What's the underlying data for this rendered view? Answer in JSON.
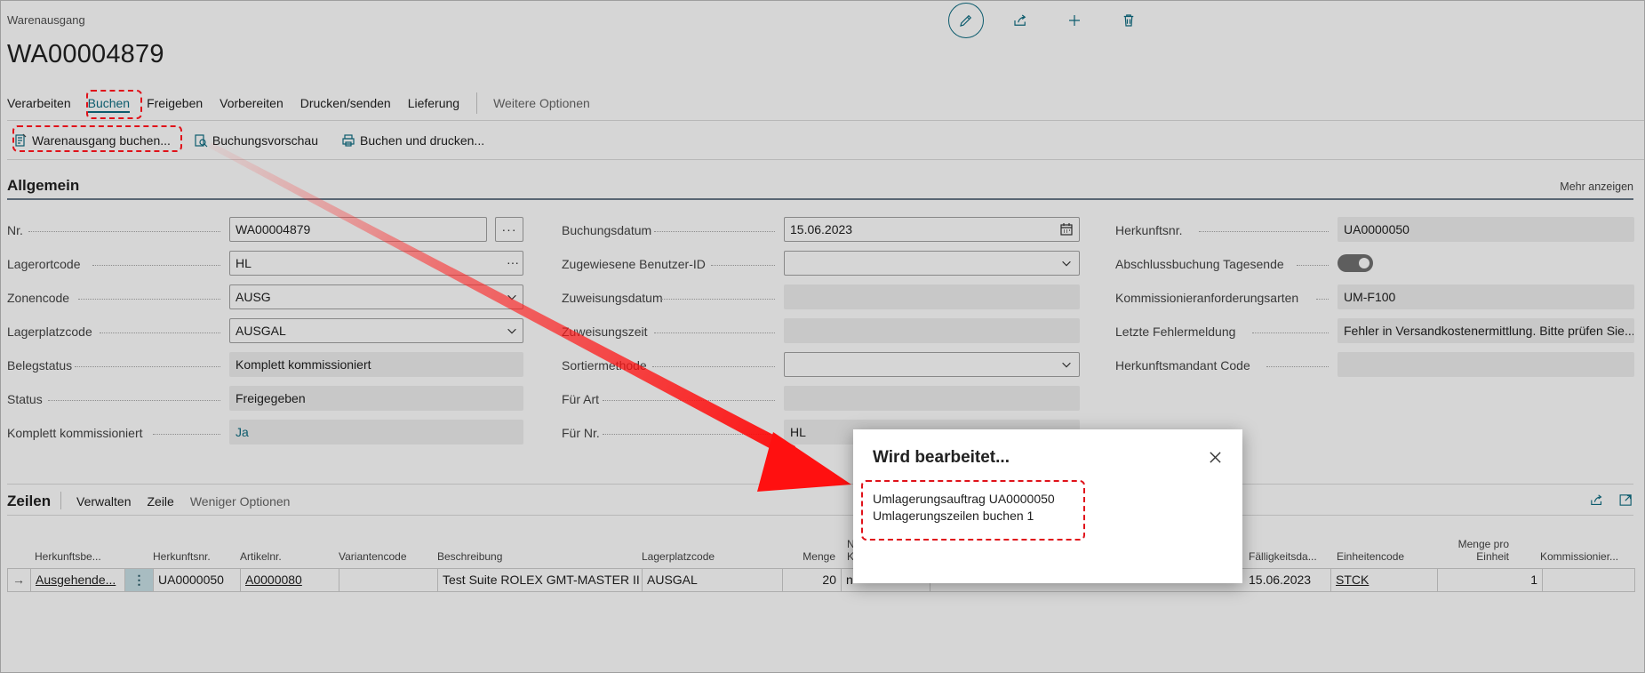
{
  "header": {
    "breadcrumb": "Warenausgang",
    "doc_no": "WA00004879",
    "actions": [
      "pencil-icon",
      "share-icon",
      "plus-icon",
      "trash-icon"
    ]
  },
  "menu": {
    "items": [
      "Verarbeiten",
      "Buchen",
      "Freigeben",
      "Vorbereiten",
      "Drucken/senden",
      "Lieferung"
    ],
    "active": "Buchen",
    "more": "Weitere Optionen"
  },
  "sub_actions": [
    "Warenausgang buchen...",
    "Buchungsvorschau",
    "Buchen und drucken..."
  ],
  "general": {
    "title": "Allgemein",
    "show_more": "Mehr anzeigen",
    "col1": [
      {
        "label": "Nr.",
        "value": "WA00004879"
      },
      {
        "label": "Lagerortcode",
        "value": "HL"
      },
      {
        "label": "Zonencode",
        "value": "AUSG"
      },
      {
        "label": "Lagerplatzcode",
        "value": "AUSGAL"
      },
      {
        "label": "Belegstatus",
        "value": "Komplett kommissioniert"
      },
      {
        "label": "Status",
        "value": "Freigegeben"
      },
      {
        "label": "Komplett kommissioniert",
        "value": "Ja"
      }
    ],
    "col2": [
      {
        "label": "Buchungsdatum",
        "value": "15.06.2023"
      },
      {
        "label": "Zugewiesene Benutzer-ID",
        "value": ""
      },
      {
        "label": "Zuweisungsdatum",
        "value": ""
      },
      {
        "label": "Zuweisungszeit",
        "value": ""
      },
      {
        "label": "Sortiermethode",
        "value": ""
      },
      {
        "label": "Für Art",
        "value": ""
      },
      {
        "label": "Für Nr.",
        "value": "HL"
      }
    ],
    "col3": [
      {
        "label": "Herkunftsnr.",
        "value": "UA0000050"
      },
      {
        "label": "Abschlussbuchung Tagesende",
        "value": ""
      },
      {
        "label": "Kommissionieranforderungsarten",
        "value": "UM-F100"
      },
      {
        "label": "Letzte Fehlermeldung",
        "value": "Fehler in Versandkostenermittlung. Bitte prüfen Sie..."
      },
      {
        "label": "Herkunftsmandant Code",
        "value": ""
      }
    ]
  },
  "lines": {
    "title": "Zeilen",
    "menu": [
      "Verwalten",
      "Zeile",
      "Weniger Optionen"
    ],
    "headers": [
      "Herkunftsbe...",
      "Herkunftsnr.",
      "Artikelnr.",
      "Variantencode",
      "Beschreibung",
      "Lagerplatzcode",
      "Menge",
      "N K",
      "Fälligkeitsda...",
      "Einheitencode",
      "Menge pro Einheit",
      "Kommissionier..."
    ],
    "row": {
      "source_doc": "Ausgehende...",
      "source_no": "UA0000050",
      "item_no": "A0000080",
      "variant": "",
      "description": "Test Suite ROLEX GMT-MASTER II",
      "bin": "AUSGAL",
      "qty": "20",
      "partial": "n",
      "due_date": "15.06.2023",
      "uom": "STCK",
      "qty_per_uom": "1",
      "picked": ""
    }
  },
  "dialog": {
    "title": "Wird bearbeitet...",
    "line1": "Umlagerungsauftrag UA0000050",
    "line2": "Umlagerungszeilen buchen 1"
  },
  "colors": {
    "accent": "#0f6d82",
    "highlight": "#e0121a"
  }
}
